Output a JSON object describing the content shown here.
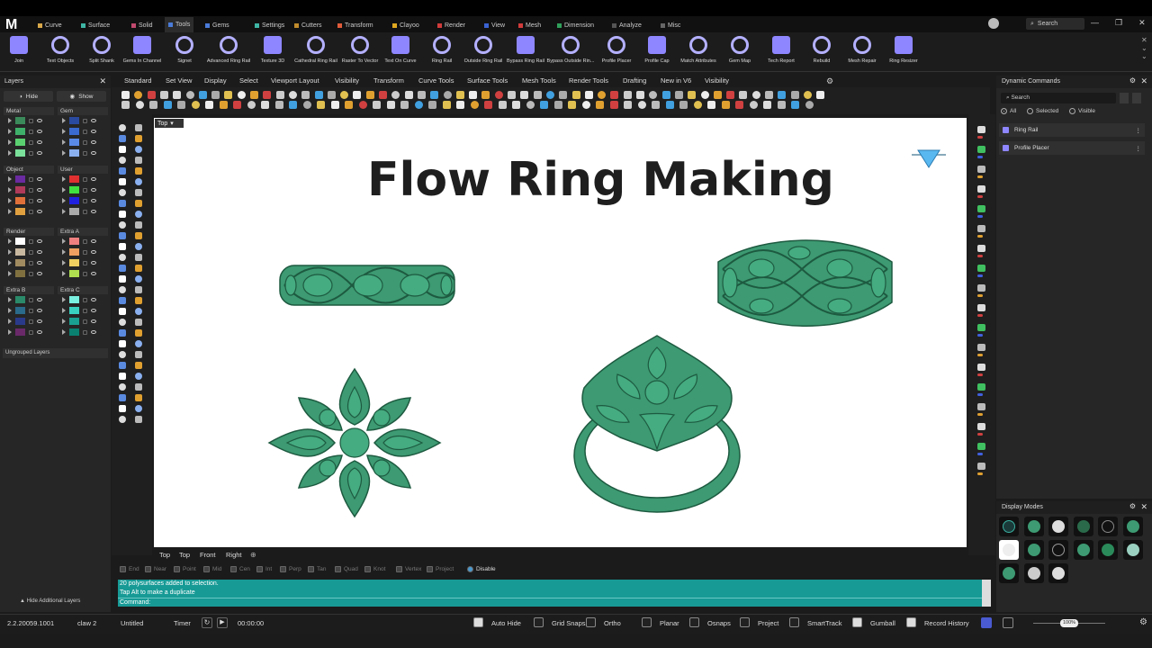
{
  "app": {
    "logo": "M",
    "search": "Search"
  },
  "top_tabs": [
    {
      "label": "Curve",
      "color": "#d8a84a"
    },
    {
      "label": "Surface",
      "color": "#3fb6a5"
    },
    {
      "label": "Solid",
      "color": "#c0496e"
    },
    {
      "label": "Tools",
      "color": "#4a7bd8"
    },
    {
      "label": "Gems",
      "color": "#4a7bd8"
    },
    {
      "label": "Settings",
      "color": "#3fb6a5"
    },
    {
      "label": "Cutters",
      "color": "#c08b2c"
    },
    {
      "label": "Transform",
      "color": "#e05b3a"
    },
    {
      "label": "Clayoo",
      "color": "#e0a820"
    },
    {
      "label": "Render",
      "color": "#d13b3b"
    },
    {
      "label": "View",
      "color": "#3a62d1"
    },
    {
      "label": "Mesh",
      "color": "#d13b3b"
    },
    {
      "label": "Dimension",
      "color": "#30a05a"
    },
    {
      "label": "Analyze",
      "color": "#555555"
    },
    {
      "label": "Misc",
      "color": "#666666"
    }
  ],
  "ribbon_tools": [
    "Join",
    "Text Objects",
    "Split Shank",
    "Gems In Channel",
    "Signet",
    "Advanced Ring Rail",
    "Texture 3D",
    "Cathedral Ring Rail",
    "Raster To Vector",
    "Text On Curve",
    "Ring Rail",
    "Outside Ring Rail",
    "Bypass Ring Rail",
    "Bypass Outside Rin...",
    "Profile Placer",
    "Profile Cap",
    "Match Attributes",
    "Gem Map",
    "Tech Report",
    "Rebuild",
    "Mesh Repair",
    "Ring Resizer"
  ],
  "layers": {
    "title": "Layers",
    "hide": "Hide",
    "show": "Show",
    "groups": [
      {
        "name": "Metal",
        "colors": [
          "#3a8a5a",
          "#3fb06a",
          "#5ad070",
          "#7ae09a"
        ]
      },
      {
        "name": "Gem",
        "colors": [
          "#2a4aa0",
          "#3a6ad0",
          "#5a8ae8",
          "#8ab0f0"
        ]
      },
      {
        "name": "Object",
        "colors": [
          "#6a2aa0",
          "#b03a5a",
          "#e0703a",
          "#e0a040"
        ]
      },
      {
        "name": "User",
        "colors": [
          "#e03030",
          "#40e040",
          "#2020e0",
          "#aaaaaa"
        ]
      },
      {
        "name": "Render",
        "colors": [
          "#ffffff",
          "#c8b8a0",
          "#a08a60",
          "#807040"
        ]
      },
      {
        "name": "Extra A",
        "colors": [
          "#f08080",
          "#f0a060",
          "#f0d060",
          "#b0e050"
        ]
      },
      {
        "name": "Extra B",
        "colors": [
          "#2a8a6a",
          "#2a6a8a",
          "#2a3a8a",
          "#6a2a6a"
        ]
      },
      {
        "name": "Extra C",
        "colors": [
          "#7af0e0",
          "#3ad0c0",
          "#1aa090",
          "#0a8070"
        ]
      }
    ],
    "ungrouped": "Ungrouped Layers",
    "hide_additional": "Hide Additional Layers"
  },
  "viewport_menu": [
    "Standard",
    "Set View",
    "Display",
    "Select",
    "Viewport Layout",
    "Visibility",
    "Transform",
    "Curve Tools",
    "Surface Tools",
    "Mesh Tools",
    "Render Tools",
    "Drafting",
    "New in V6",
    "Visibility"
  ],
  "viewport": {
    "label": "Top",
    "title": "Flow Ring Making",
    "tabs": [
      "Top",
      "Top",
      "Front",
      "Right"
    ],
    "metal_color": "#3d9a72",
    "outline_color": "#1d5a40"
  },
  "osnaps": [
    {
      "label": "End",
      "on": false
    },
    {
      "label": "Near",
      "on": false
    },
    {
      "label": "Point",
      "on": false
    },
    {
      "label": "Mid",
      "on": false
    },
    {
      "label": "Cen",
      "on": false
    },
    {
      "label": "Int",
      "on": false
    },
    {
      "label": "Perp",
      "on": false
    },
    {
      "label": "Tan",
      "on": false
    },
    {
      "label": "Quad",
      "on": false
    },
    {
      "label": "Knot",
      "on": false
    },
    {
      "label": "Vertex",
      "on": false
    },
    {
      "label": "Project",
      "on": false
    },
    {
      "label": "Disable",
      "on": true
    }
  ],
  "command": {
    "line1": "20 polysurfaces added to selection.",
    "line2": "Tap Alt to make a duplicate",
    "prompt": "Command:"
  },
  "dynamic_commands": {
    "title": "Dynamic Commands",
    "search": "Search",
    "filters": [
      "All",
      "Selected",
      "Visible"
    ],
    "items": [
      "Ring Rail",
      "Profile Placer"
    ]
  },
  "display_modes": {
    "title": "Display Modes"
  },
  "status": {
    "version": "2.2.20059.1001",
    "layer": "claw 2",
    "file": "Untitled",
    "timer_label": "Timer",
    "time": "00:00:00",
    "toggles": [
      {
        "label": "Auto Hide",
        "on": true
      },
      {
        "label": "Grid Snaps",
        "on": false
      },
      {
        "label": "Ortho",
        "on": false
      },
      {
        "label": "Planar",
        "on": false
      },
      {
        "label": "Osnaps",
        "on": false
      },
      {
        "label": "Project",
        "on": false
      },
      {
        "label": "SmartTrack",
        "on": false
      },
      {
        "label": "Gumball",
        "on": true
      },
      {
        "label": "Record History",
        "on": true
      }
    ],
    "zoom": "100%"
  }
}
